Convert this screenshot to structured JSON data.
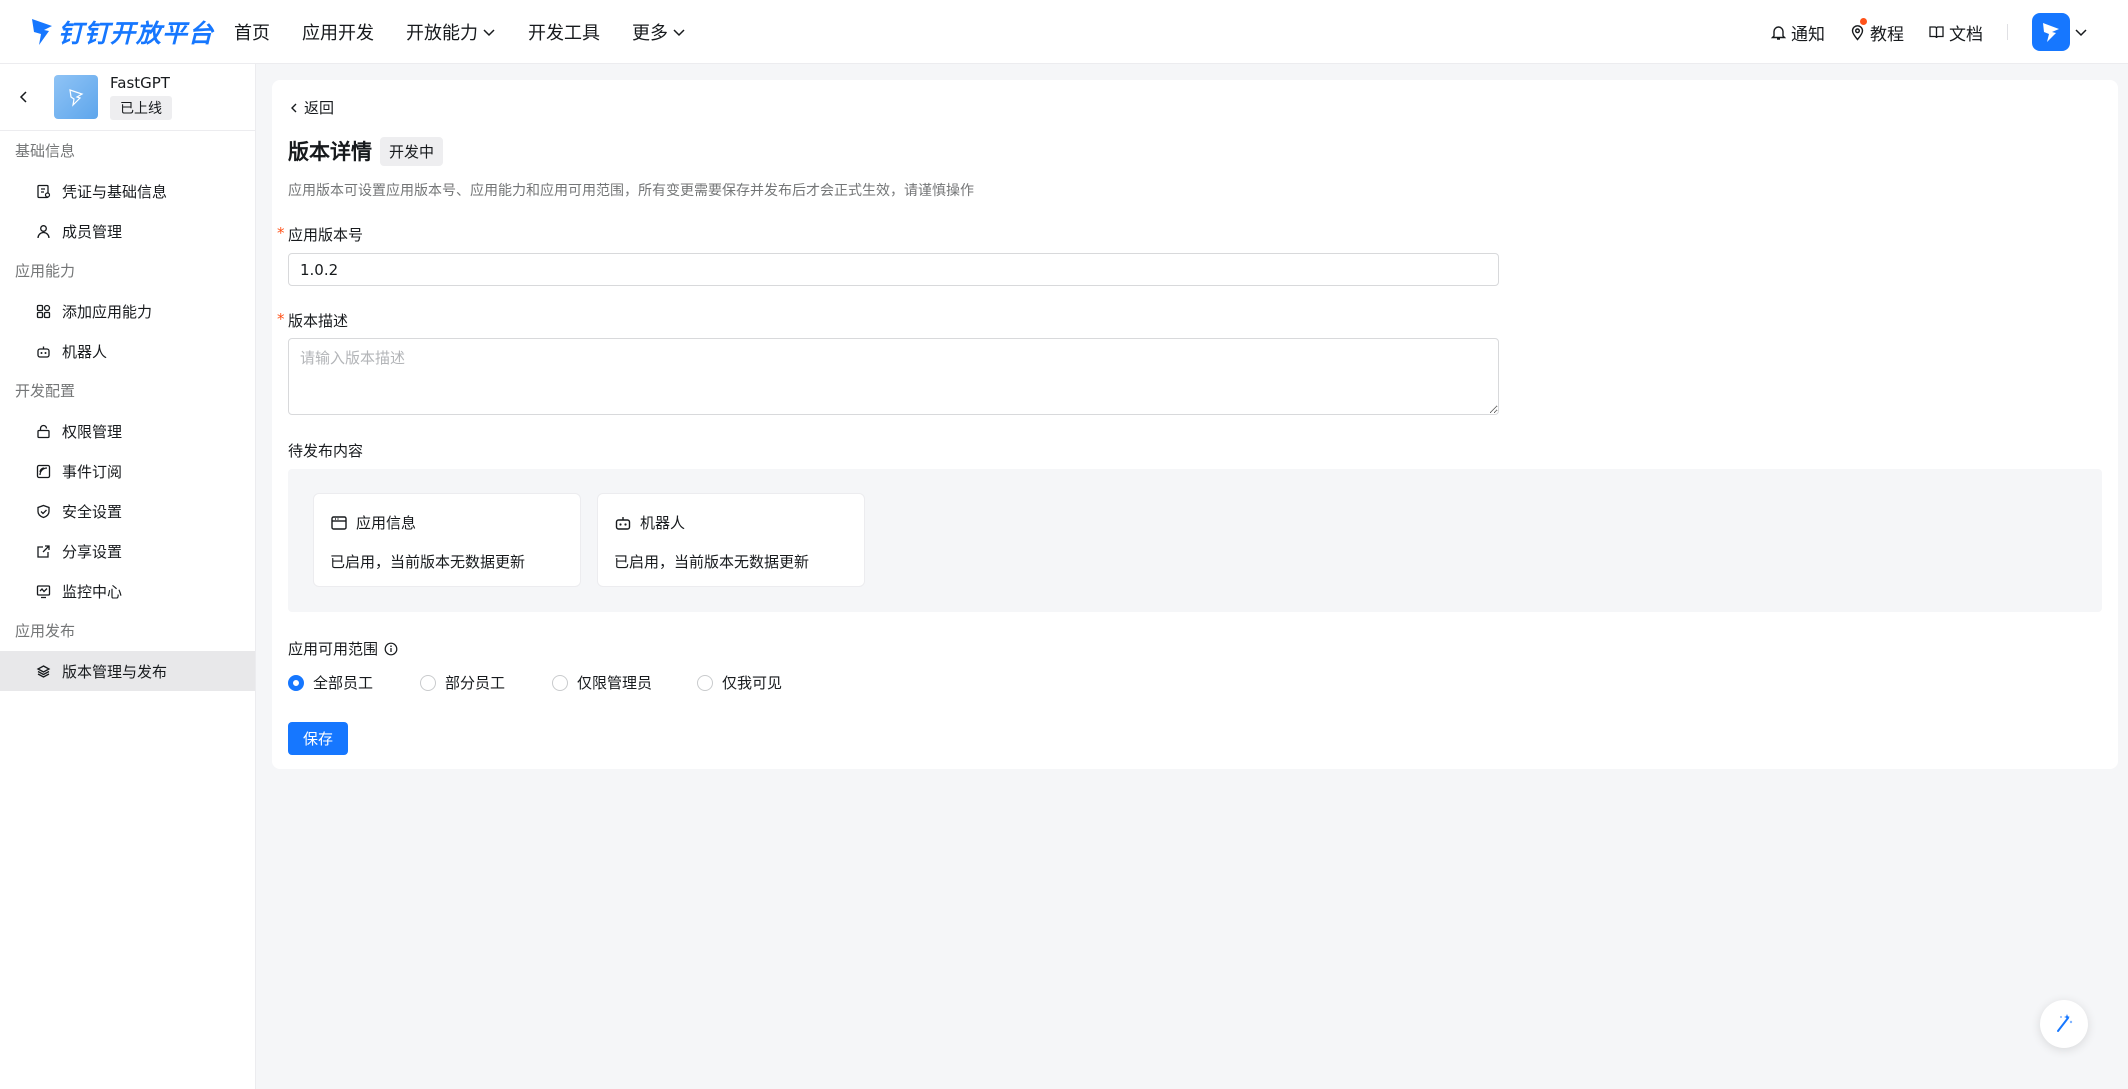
{
  "brand": {
    "name": "钉钉开放平台",
    "color": "#1677ff"
  },
  "nav": {
    "items": [
      {
        "label": "首页",
        "has_chevron": false
      },
      {
        "label": "应用开发",
        "has_chevron": false
      },
      {
        "label": "开放能力",
        "has_chevron": true
      },
      {
        "label": "开发工具",
        "has_chevron": false
      },
      {
        "label": "更多",
        "has_chevron": true
      }
    ],
    "right": {
      "notify": "通知",
      "tutorial": "教程",
      "docs": "文档"
    }
  },
  "sidebar": {
    "app": {
      "name": "FastGPT",
      "status": "已上线"
    },
    "groups": [
      {
        "title": "基础信息",
        "items": [
          {
            "label": "凭证与基础信息",
            "icon": "credential-icon"
          },
          {
            "label": "成员管理",
            "icon": "user-icon"
          }
        ]
      },
      {
        "title": "应用能力",
        "items": [
          {
            "label": "添加应用能力",
            "icon": "apps-add-icon"
          },
          {
            "label": "机器人",
            "icon": "robot-icon"
          }
        ]
      },
      {
        "title": "开发配置",
        "items": [
          {
            "label": "权限管理",
            "icon": "lock-icon"
          },
          {
            "label": "事件订阅",
            "icon": "event-icon"
          },
          {
            "label": "安全设置",
            "icon": "shield-icon"
          },
          {
            "label": "分享设置",
            "icon": "share-icon"
          },
          {
            "label": "监控中心",
            "icon": "monitor-icon"
          }
        ]
      },
      {
        "title": "应用发布",
        "items": [
          {
            "label": "版本管理与发布",
            "icon": "layers-icon",
            "active": true
          }
        ]
      }
    ]
  },
  "main": {
    "back": "返回",
    "title": "版本详情",
    "badge": "开发中",
    "description": "应用版本可设置应用版本号、应用能力和应用可用范围，所有变更需要保存并发布后才会正式生效，请谨慎操作",
    "version_label": "应用版本号",
    "version_value": "1.0.2",
    "desc_label": "版本描述",
    "desc_placeholder": "请输入版本描述",
    "pending_label": "待发布内容",
    "pending": [
      {
        "title": "应用信息",
        "body": "已启用，当前版本无数据更新"
      },
      {
        "title": "机器人",
        "body": "已启用，当前版本无数据更新"
      }
    ],
    "scope_label": "应用可用范围",
    "scope_options": [
      "全部员工",
      "部分员工",
      "仅限管理员",
      "仅我可见"
    ],
    "scope_selected": "全部员工",
    "save": "保存"
  }
}
